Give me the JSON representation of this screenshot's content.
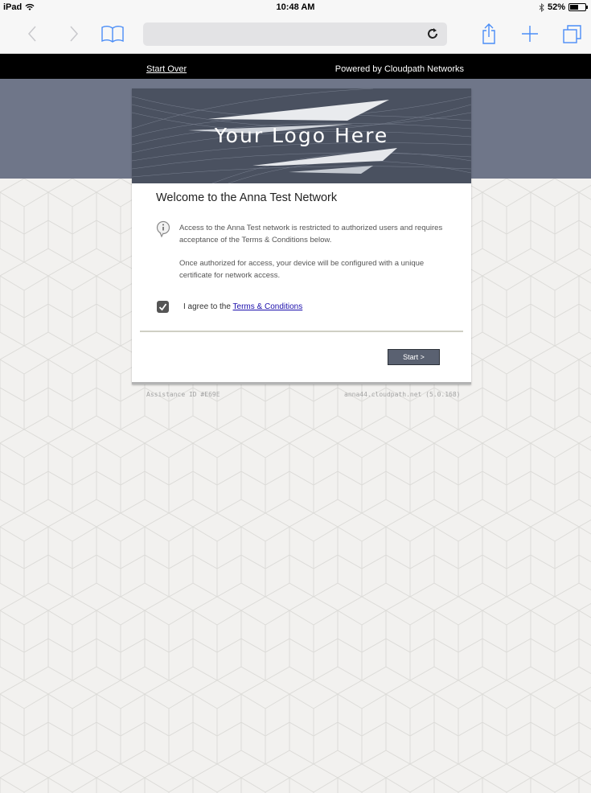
{
  "status_bar": {
    "device": "iPad",
    "time": "10:48 AM",
    "battery": "52%"
  },
  "toolbar": {
    "back_icon": "chevron-left-icon",
    "forward_icon": "chevron-right-icon",
    "bookmarks_icon": "book-icon",
    "reload_icon": "reload-icon",
    "share_icon": "share-icon",
    "add_icon": "plus-icon",
    "tabs_icon": "tabs-icon"
  },
  "header": {
    "start_over": "Start Over",
    "powered_by": "Powered by Cloudpath Networks"
  },
  "card": {
    "logo_text": "Your Logo Here",
    "title": "Welcome to the Anna Test Network",
    "paragraph1": "Access to the Anna Test network is restricted to authorized users and requires acceptance of the Terms & Conditions below.",
    "paragraph2": "Once authorized for access, your device will be configured with a unique certificate for network access.",
    "agree_prefix": "I agree to the ",
    "terms_link": "Terms & Conditions",
    "agree_checked": true,
    "start_button": "Start >"
  },
  "footer": {
    "assistance_id": "Assistance ID #E69E",
    "server": "anna44.cloudpath.net (5.0.168)"
  },
  "colors": {
    "topbar": "#000000",
    "banner": "#6f7689",
    "logo_bg": "#4a5160",
    "button": "#5a6171",
    "link": "#1a0dab"
  }
}
